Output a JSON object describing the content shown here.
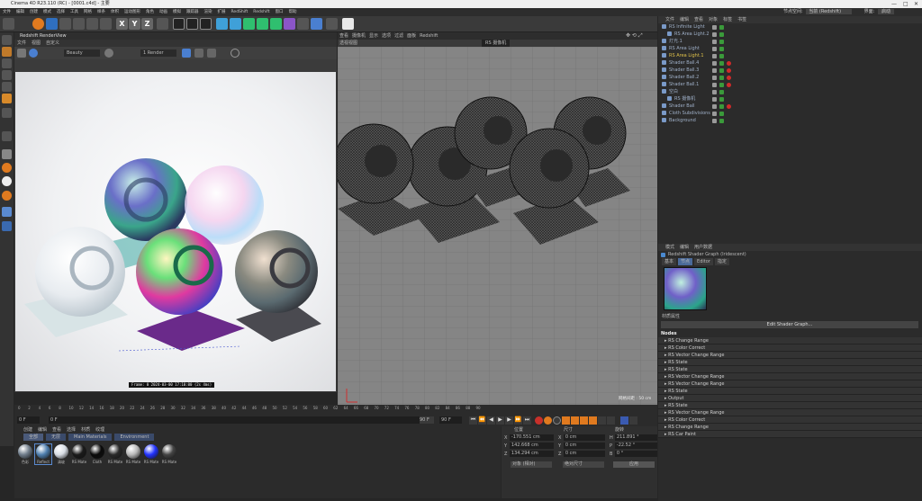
{
  "window": {
    "title": "Cinema 4D R23.110 (RC) - [0001.c4d] - 主要"
  },
  "menubar": {
    "items": [
      "文件",
      "编辑",
      "创建",
      "模式",
      "选择",
      "工具",
      "网格",
      "样条",
      "体积",
      "运动图形",
      "角色",
      "动画",
      "模拟",
      "跟踪器",
      "渲染",
      "扩展",
      "RedShift",
      "Redshift",
      "窗口",
      "帮助"
    ]
  },
  "topright": {
    "node_label": "节点空间:",
    "node_value": "当前 (Redshift)",
    "layout_label": "界面:",
    "layout_value": "启动"
  },
  "toolbar": {
    "xyz": [
      "X",
      "Y",
      "Z"
    ]
  },
  "renderview": {
    "title": "Redshift RenderView",
    "menu": [
      "文件",
      "视图",
      "自定义"
    ],
    "mode": "Beauty",
    "zoom_label": "1 Render",
    "status": "Frame: 0   2024-03-00   17:10:00   (2s 4ms)"
  },
  "viewport": {
    "menu": [
      "查看",
      "摄像机",
      "显示",
      "选项",
      "过滤",
      "面板",
      "Redshift"
    ],
    "camera": "透视视图",
    "camera_tag": "RS 摄像机",
    "grid_info": "网格间距 : 50 cm"
  },
  "timeline": {
    "ticks": [
      "0",
      "2",
      "4",
      "6",
      "8",
      "10",
      "12",
      "14",
      "16",
      "18",
      "20",
      "22",
      "24",
      "26",
      "28",
      "30",
      "32",
      "34",
      "36",
      "38",
      "40",
      "42",
      "44",
      "46",
      "48",
      "50",
      "52",
      "54",
      "56",
      "58",
      "60",
      "62",
      "64",
      "66",
      "68",
      "70",
      "72",
      "74",
      "76",
      "78",
      "80",
      "82",
      "84",
      "86",
      "88",
      "90"
    ],
    "current": "0 F",
    "start": "0 F",
    "end_a": "90 F",
    "end_b": "90 F"
  },
  "materials": {
    "menu": [
      "创建",
      "编辑",
      "查看",
      "选择",
      "材质",
      "纹理"
    ],
    "tabs": [
      "全部",
      "无层",
      "Main Materials",
      "Environment"
    ],
    "items": [
      {
        "label": "色彩",
        "color": "#6f7c8a"
      },
      {
        "label": "Reflect",
        "color": "#4f7fae"
      },
      {
        "label": "清玻",
        "color": "#d8dde4"
      },
      {
        "label": "RS Mate",
        "color": "#1a1a1a"
      },
      {
        "label": "Cloth",
        "color": "#0a0a0a"
      },
      {
        "label": "RS Mate",
        "color": "#2a2a2a"
      },
      {
        "label": "RS Mate",
        "color": "#b8b8b8"
      },
      {
        "label": "RS Mate",
        "color": "#2233ff"
      },
      {
        "label": "RS Mate",
        "color": "#444444"
      }
    ]
  },
  "coords": {
    "headers": [
      "位置",
      "尺寸",
      "旋转"
    ],
    "rows": [
      {
        "axis": "X",
        "pos": "-170.551 cm",
        "size": "0 cm",
        "rot_label": "H",
        "rot": "211.891 °"
      },
      {
        "axis": "Y",
        "pos": "142.668 cm",
        "size": "0 cm",
        "rot_label": "P",
        "rot": "-22.52 °"
      },
      {
        "axis": "Z",
        "pos": "134.294 cm",
        "size": "0 cm",
        "rot_label": "B",
        "rot": "0 °"
      }
    ],
    "mode_a": "对象 (相对)",
    "mode_b": "绝对尺寸",
    "apply": "应用"
  },
  "objects": {
    "menu": [
      "文件",
      "编辑",
      "查看",
      "对象",
      "标签",
      "书签"
    ],
    "items": [
      {
        "name": "RS Infinite Light",
        "indent": 0,
        "color": "#9fb0c8"
      },
      {
        "name": "RS Area Light.2",
        "indent": 1,
        "color": "#9fb0c8"
      },
      {
        "name": "灯光.1",
        "indent": 0,
        "color": "#9fb0c8"
      },
      {
        "name": "RS Area Light",
        "indent": 0,
        "color": "#9fb0c8"
      },
      {
        "name": "RS Area Light.1",
        "indent": 0,
        "color": "#e0c24a"
      },
      {
        "name": "Shader Ball.4",
        "indent": 0,
        "color": "#9fb0c8"
      },
      {
        "name": "Shader Ball.3",
        "indent": 0,
        "color": "#9fb0c8"
      },
      {
        "name": "Shader Ball.2",
        "indent": 0,
        "color": "#9fb0c8"
      },
      {
        "name": "Shader Ball.1",
        "indent": 0,
        "color": "#9fb0c8"
      },
      {
        "name": "空白",
        "indent": 0,
        "color": "#9fb0c8"
      },
      {
        "name": "RS 摄像机",
        "indent": 1,
        "color": "#9fb0c8"
      },
      {
        "name": "Shader Ball",
        "indent": 0,
        "color": "#9fb0c8"
      },
      {
        "name": "Cloth Subdivisions",
        "indent": 0,
        "color": "#9fb0c8"
      },
      {
        "name": "Background",
        "indent": 0,
        "color": "#9fb0c8"
      }
    ]
  },
  "attributes": {
    "menu": [
      "模式",
      "编辑",
      "用户数据"
    ],
    "title": "Redshift Shader Graph (Iridescent)",
    "tabs": [
      "基本",
      "节点",
      "Editor",
      "指定"
    ],
    "section": "材质属性",
    "edit_button": "Edit Shader Graph...",
    "nodes_label": "Nodes",
    "nodes": [
      "RS Change Range",
      "RS Color Correct",
      "RS Vector Change Range",
      "RS State",
      "RS State",
      "RS Vector Change Range",
      "RS Vector Change Range",
      "RS State",
      "Output",
      "RS State",
      "RS Vector Change Range",
      "RS Color Correct",
      "RS Change Range",
      "RS Car Paint"
    ]
  }
}
